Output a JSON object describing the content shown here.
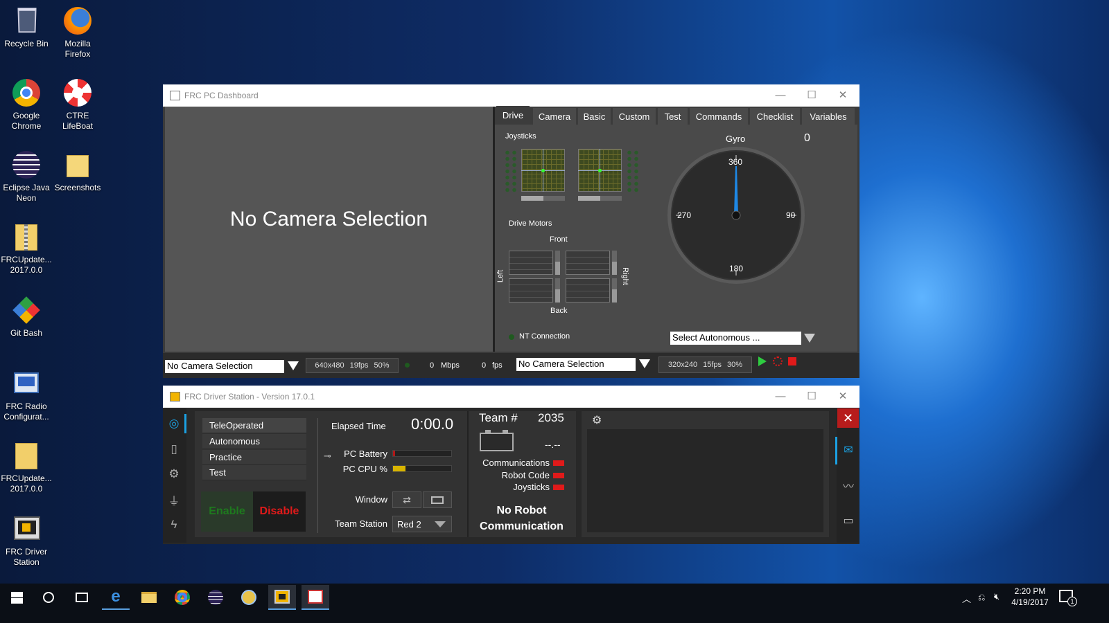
{
  "desktop": {
    "icons": [
      {
        "label": "Recycle Bin",
        "icon": "recycle-bin-icon"
      },
      {
        "label": "Mozilla Firefox",
        "icon": "firefox-icon"
      },
      {
        "label": "Google Chrome",
        "icon": "chrome-icon"
      },
      {
        "label": "CTRE LifeBoat",
        "icon": "lifeboat-icon"
      },
      {
        "label": "Eclipse Java Neon",
        "icon": "eclipse-icon"
      },
      {
        "label": "Screenshots",
        "icon": "folder-icon"
      },
      {
        "label": "FRCUpdate... 2017.0.0",
        "icon": "zip-folder-icon"
      },
      {
        "label": "Git Bash",
        "icon": "git-icon"
      },
      {
        "label": "FRC Radio Configurat...",
        "icon": "radio-config-icon"
      },
      {
        "label": "FRCUpdate... 2017.0.0",
        "icon": "zip-folder-icon"
      },
      {
        "label": "FRC Driver Station",
        "icon": "driver-station-icon"
      }
    ]
  },
  "dashboard": {
    "title": "FRC PC Dashboard",
    "camera_placeholder": "No Camera Selection",
    "tabs": [
      "Drive",
      "Camera",
      "Basic",
      "Custom",
      "Test",
      "Commands",
      "Checklist",
      "Variables"
    ],
    "joysticks_label": "Joysticks",
    "gyro": {
      "label": "Gyro",
      "value": "0",
      "ticks": {
        "top": "360",
        "right": "90",
        "bottom": "180",
        "left": "270"
      }
    },
    "drive_motors": {
      "label": "Drive Motors",
      "front": "Front",
      "back": "Back",
      "left": "Left",
      "right": "Right"
    },
    "nt_connection": "NT Connection",
    "autonomous_select": "Select Autonomous ...",
    "bottom": {
      "camera_select_1": "No Camera Selection",
      "res1": "640x480",
      "fps1": "19fps",
      "q1": "50%",
      "mbps_value": "0",
      "mbps_unit": "Mbps",
      "fps_value": "0",
      "fps_unit": "fps",
      "camera_select_2": "No Camera Selection",
      "res2": "320x240",
      "fps2": "15fps",
      "q2": "30%"
    }
  },
  "driver_station": {
    "title": "FRC Driver Station - Version 17.0.1",
    "modes": [
      "TeleOperated",
      "Autonomous",
      "Practice",
      "Test"
    ],
    "enable": "Enable",
    "disable": "Disable",
    "elapsed_label": "Elapsed Time",
    "elapsed_value": "0:00.0",
    "pc_battery": "PC Battery",
    "pc_cpu": "PC CPU %",
    "cpu_level": 0.22,
    "window_label": "Window",
    "team_station_label": "Team Station",
    "team_station_value": "Red 2",
    "team_label": "Team #",
    "team_number": "2035",
    "battery_voltage": "--.--",
    "communications": "Communications",
    "robot_code": "Robot Code",
    "joysticks": "Joysticks",
    "status_line1": "No Robot",
    "status_line2": "Communication"
  },
  "taskbar": {
    "time": "2:20 PM",
    "date": "4/19/2017",
    "notifications": "1"
  },
  "colors": {
    "accent": "#1ba1e2",
    "indicator_red": "#e01a1a",
    "enable_green": "#1e7a1e",
    "disable_red": "#e01a1a",
    "cpu_yellow": "#d8b400"
  }
}
